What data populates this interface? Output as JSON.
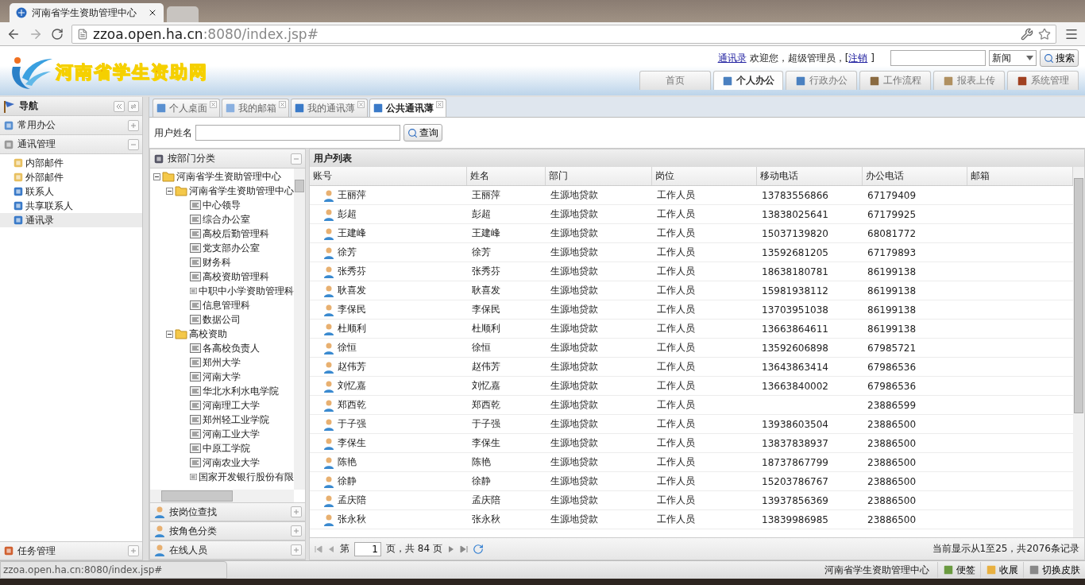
{
  "browser": {
    "tab_title": "河南省学生资助管理中心",
    "address": "zzoa.open.ha.cn",
    "address_rest": ":8080/index.jsp#"
  },
  "header": {
    "site_title": "河南省学生资助网",
    "contacts_link": "通讯录",
    "welcome": "欢迎您，超级管理员，[",
    "logout_link": "注销",
    "bracket_close": "]",
    "search_category": "新闻",
    "search_button": "搜索",
    "nav_tabs": [
      {
        "label": "首页",
        "selected": false
      },
      {
        "label": "个人办公",
        "selected": true
      },
      {
        "label": "行政办公",
        "selected": false
      },
      {
        "label": "工作流程",
        "selected": false
      },
      {
        "label": "报表上传",
        "selected": false
      },
      {
        "label": "系统管理",
        "selected": false
      }
    ]
  },
  "sidebar": {
    "title": "导航",
    "sections": [
      {
        "label": "常用办公",
        "expanded": false
      },
      {
        "label": "通讯管理",
        "expanded": true,
        "items": [
          {
            "label": "内部邮件",
            "selected": false
          },
          {
            "label": "外部邮件",
            "selected": false
          },
          {
            "label": "联系人",
            "selected": false
          },
          {
            "label": "共享联系人",
            "selected": false
          },
          {
            "label": "通讯录",
            "selected": true
          }
        ]
      }
    ],
    "bottom_section": {
      "label": "任务管理",
      "expanded": false
    }
  },
  "content_tabs": [
    {
      "label": "个人桌面",
      "selected": false
    },
    {
      "label": "我的邮箱",
      "selected": false
    },
    {
      "label": "我的通讯薄",
      "selected": false
    },
    {
      "label": "公共通讯薄",
      "selected": true
    }
  ],
  "search": {
    "label": "用户姓名",
    "button": "查询"
  },
  "tree_panel": {
    "title": "按部门分类",
    "tree": [
      {
        "label": "河南省学生资助管理中心",
        "children": [
          {
            "label": "河南省学生资助管理中心",
            "children": [
              {
                "label": "中心领导"
              },
              {
                "label": "综合办公室"
              },
              {
                "label": "高校后勤管理科"
              },
              {
                "label": "党支部办公室"
              },
              {
                "label": "财务科"
              },
              {
                "label": "高校资助管理科"
              },
              {
                "label": "中职中小学资助管理科"
              },
              {
                "label": "信息管理科"
              },
              {
                "label": "数据公司"
              }
            ]
          },
          {
            "label": "高校资助",
            "children": [
              {
                "label": "各高校负责人"
              },
              {
                "label": "郑州大学"
              },
              {
                "label": "河南大学"
              },
              {
                "label": "华北水利水电学院"
              },
              {
                "label": "河南理工大学"
              },
              {
                "label": "郑州轻工业学院"
              },
              {
                "label": "河南工业大学"
              },
              {
                "label": "中原工学院"
              },
              {
                "label": "河南农业大学"
              },
              {
                "label": "国家开发银行股份有限"
              }
            ]
          }
        ]
      }
    ],
    "sections": [
      "按岗位查找",
      "按角色分类",
      "在线人员"
    ]
  },
  "user_list": {
    "title": "用户列表",
    "columns": [
      "账号",
      "姓名",
      "部门",
      "岗位",
      "移动电话",
      "办公电话",
      "邮箱"
    ],
    "rows": [
      [
        "王丽萍",
        "王丽萍",
        "生源地贷款",
        "工作人员",
        "13783556866",
        "67179409"
      ],
      [
        "彭超",
        "彭超",
        "生源地贷款",
        "工作人员",
        "13838025641",
        "67179925"
      ],
      [
        "王建峰",
        "王建峰",
        "生源地贷款",
        "工作人员",
        "15037139820",
        "68081772"
      ],
      [
        "徐芳",
        "徐芳",
        "生源地贷款",
        "工作人员",
        "13592681205",
        "67179893"
      ],
      [
        "张秀芬",
        "张秀芬",
        "生源地贷款",
        "工作人员",
        "18638180781",
        "86199138"
      ],
      [
        "耿喜发",
        "耿喜发",
        "生源地贷款",
        "工作人员",
        "15981938112",
        "86199138"
      ],
      [
        "李保民",
        "李保民",
        "生源地贷款",
        "工作人员",
        "13703951038",
        "86199138"
      ],
      [
        "杜顺利",
        "杜顺利",
        "生源地贷款",
        "工作人员",
        "13663864611",
        "86199138"
      ],
      [
        "徐恒",
        "徐恒",
        "生源地贷款",
        "工作人员",
        "13592606898",
        "67985721"
      ],
      [
        "赵伟芳",
        "赵伟芳",
        "生源地贷款",
        "工作人员",
        "13643863414",
        "67986536"
      ],
      [
        "刘忆嘉",
        "刘忆嘉",
        "生源地贷款",
        "工作人员",
        "13663840002",
        "67986536"
      ],
      [
        "郑西乾",
        "郑西乾",
        "生源地贷款",
        "工作人员",
        null,
        "23886599"
      ],
      [
        "于子强",
        "于子强",
        "生源地贷款",
        "工作人员",
        "13938603504",
        "23886500"
      ],
      [
        "李保生",
        "李保生",
        "生源地贷款",
        "工作人员",
        "13837838937",
        "23886500"
      ],
      [
        "陈艳",
        "陈艳",
        "生源地贷款",
        "工作人员",
        "18737867799",
        "23886500"
      ],
      [
        "徐静",
        "徐静",
        "生源地贷款",
        "工作人员",
        "15203786767",
        "23886500"
      ],
      [
        "孟庆陪",
        "孟庆陪",
        "生源地贷款",
        "工作人员",
        "13937856369",
        "23886500"
      ],
      [
        "张永秋",
        "张永秋",
        "生源地贷款",
        "工作人员",
        "13839986985",
        "23886500"
      ]
    ],
    "pager": {
      "page_prefix": "第",
      "page": "1",
      "page_suffix": "页，共 84 页",
      "summary": "当前显示从1至25，共2076条记录"
    }
  },
  "status": {
    "link_preview": "zzoa.open.ha.cn:8080/index.jsp#",
    "org": "河南省学生资助管理中心",
    "buttons": [
      "便签",
      "收展",
      "切换皮肤"
    ]
  }
}
